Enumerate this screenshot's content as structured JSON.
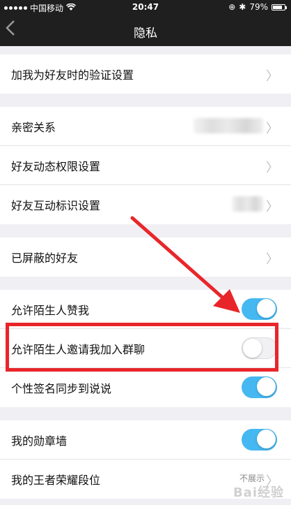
{
  "status_bar": {
    "carrier": "中国移动",
    "time": "20:47",
    "battery": "79%",
    "battery_level": 0.79
  },
  "nav": {
    "title": "隐私",
    "back_icon": "chevron-left-icon"
  },
  "sections": [
    {
      "items": [
        {
          "label": "加我为好友时的验证设置",
          "type": "chevron"
        }
      ]
    },
    {
      "items": [
        {
          "label": "亲密关系",
          "type": "blurred"
        },
        {
          "label": "好友动态权限设置",
          "type": "chevron"
        },
        {
          "label": "好友互动标识设置",
          "type": "blurred"
        }
      ]
    },
    {
      "items": [
        {
          "label": "已屏蔽的好友",
          "type": "chevron"
        }
      ]
    },
    {
      "items": [
        {
          "label": "允许陌生人赞我",
          "type": "toggle",
          "on": true
        },
        {
          "label": "允许陌生人邀请我加入群聊",
          "type": "toggle",
          "on": false
        },
        {
          "label": "个性签名同步到说说",
          "type": "toggle",
          "on": true
        }
      ]
    },
    {
      "items": [
        {
          "label": "我的勋章墙",
          "type": "toggle",
          "on": true
        },
        {
          "label": "我的王者荣耀段位",
          "type": "chevron",
          "value": "不展示"
        }
      ]
    }
  ],
  "annotation": {
    "highlight_color": "#e8262a",
    "toggle_on_color": "#45b8f1"
  },
  "watermark": "Bai经验"
}
